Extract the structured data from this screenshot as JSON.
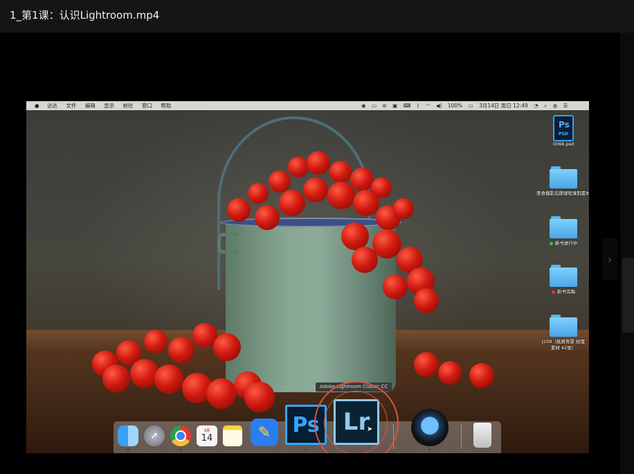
{
  "window": {
    "title": "1_第1课：认识Lightroom.mp4"
  },
  "menubar": {
    "apple": "",
    "menus": [
      "访达",
      "文件",
      "编辑",
      "显示",
      "前往",
      "窗口",
      "帮助"
    ],
    "status": {
      "battery": "100%",
      "datetime": "3月14日 周日 12:49"
    }
  },
  "desktop": {
    "items": [
      {
        "label": "0066.psd",
        "kind": "psd",
        "badge": "Ps",
        "ext": "PSD"
      },
      {
        "label": "美食摄影后期课程录制素材",
        "kind": "folder"
      },
      {
        "label": "新书进行中",
        "kind": "folder",
        "tag_color": "#3fbf4a"
      },
      {
        "label": "新书完稿",
        "kind": "folder",
        "tag_color": "#e03a2f"
      },
      {
        "label": "J109（纸质背景 纹理 素材 42张）",
        "kind": "folder"
      }
    ]
  },
  "dock": {
    "tooltip": "Adobe Lightroom Classic CC",
    "icons": [
      {
        "name": "finder-icon"
      },
      {
        "name": "launchpad-icon"
      },
      {
        "name": "chrome-icon"
      },
      {
        "name": "calendar-icon",
        "month": "3月",
        "day": "14"
      },
      {
        "name": "notes-icon"
      },
      {
        "name": "pencil-app-icon"
      },
      {
        "name": "photoshop-icon",
        "text": "Ps"
      },
      {
        "name": "lightroom-icon",
        "text": "Lr"
      },
      {
        "name": "quicktime-icon"
      },
      {
        "name": "trash-icon"
      }
    ]
  },
  "colors": {
    "accent_ring": "#e0533b",
    "ps_blue": "#31a8ff",
    "lr_blue": "#8fc9f0"
  }
}
